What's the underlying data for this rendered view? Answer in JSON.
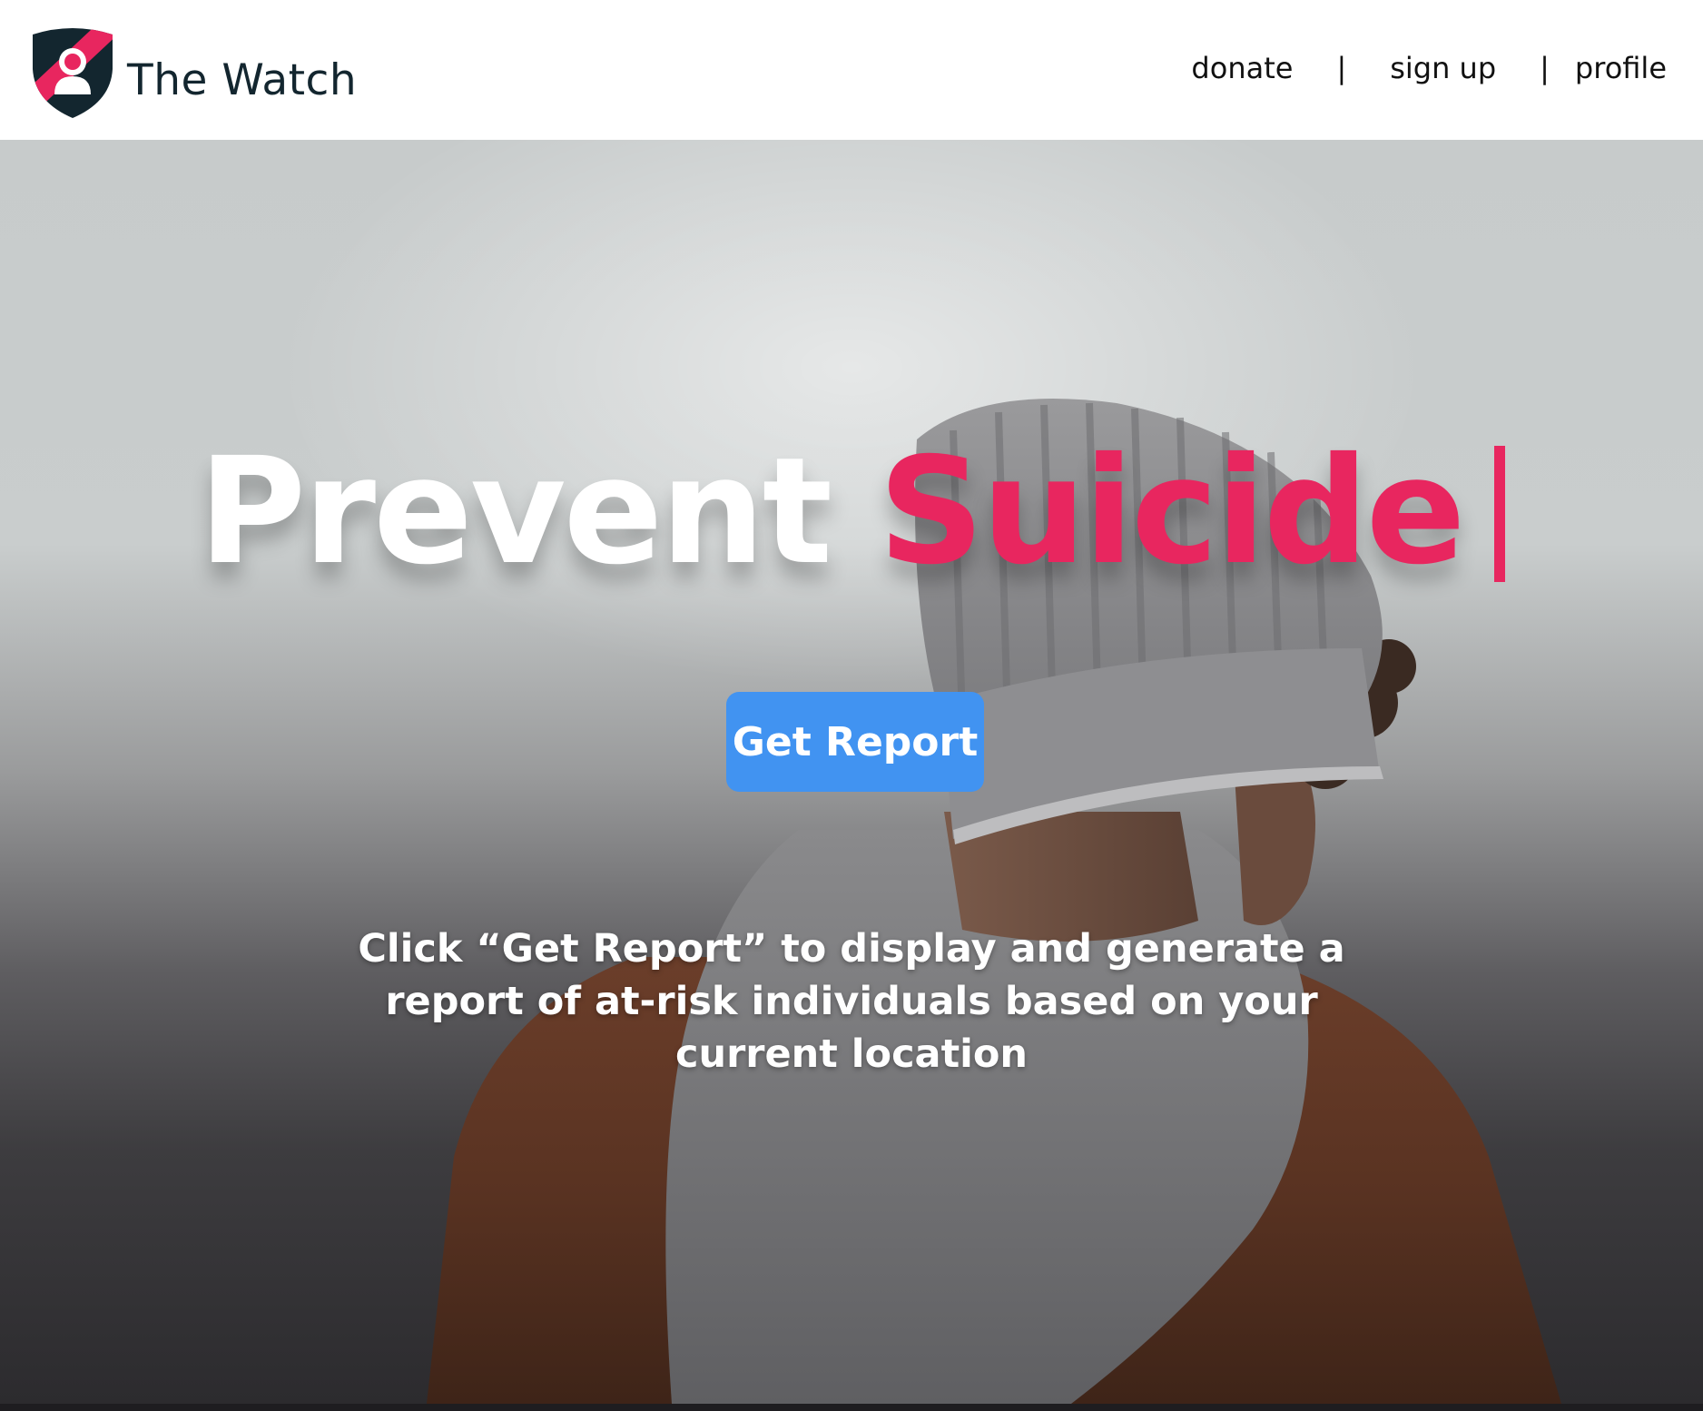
{
  "header": {
    "brand_name": "The Watch",
    "nav": [
      {
        "label": "donate"
      },
      {
        "label": "sign up"
      },
      {
        "label": "profile"
      }
    ],
    "separator": "|"
  },
  "hero": {
    "title_word_1": "Prevent",
    "title_word_2": "Suicide",
    "button_label": "Get Report",
    "description": "Click “Get Report” to display and generate a report of at-risk individuals based on your current location"
  },
  "colors": {
    "accent_pink": "#e8265f",
    "button_blue": "#4193f1",
    "brand_dark": "#13262f"
  },
  "icons": {
    "logo": "shield-person-icon"
  }
}
